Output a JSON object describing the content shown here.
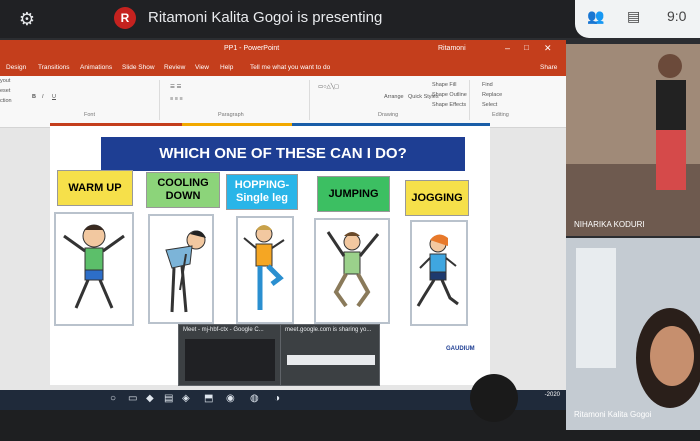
{
  "meet": {
    "avatar_letter": "R",
    "presenting_title": "Ritamoni Kalita Gogoi is presenting",
    "time": "9:0"
  },
  "ppt": {
    "doc_title": "PP1 - PowerPoint",
    "user": "Ritamoni",
    "menu": [
      "Design",
      "Transitions",
      "Animations",
      "Slide Show",
      "Review",
      "View",
      "Help",
      "Tell me what you want to do",
      "Share"
    ],
    "left_stub": [
      "yout",
      "eset",
      "ction"
    ],
    "groups": [
      "Font",
      "Paragraph",
      "Drawing",
      "Editing"
    ],
    "tools": [
      "Arrange",
      "Quick Styles",
      "Shape Fill",
      "Shape Outline",
      "Shape Effects",
      "Find",
      "Replace",
      "Select"
    ]
  },
  "slide": {
    "heading": "WHICH ONE OF THESE CAN I DO?",
    "options": [
      {
        "label": "WARM UP",
        "color": "#f6e04a"
      },
      {
        "label": "COOLING DOWN",
        "color": "#8cd47a"
      },
      {
        "label": "HOPPING- Single leg",
        "color": "#29b5e8"
      },
      {
        "label": "JUMPING",
        "color": "#3cbf62"
      },
      {
        "label": "JOGGING",
        "color": "#f6e04a"
      }
    ],
    "logo": "GAUDIUM"
  },
  "popups": [
    "Meet - mj-hbf-ctx - Google C...",
    "meet.google.com is sharing yo..."
  ],
  "participants": [
    {
      "name": "NIHARIKA KODURI"
    },
    {
      "name": "Ritamoni Kalita Gogoi"
    }
  ],
  "clock": "-2020"
}
